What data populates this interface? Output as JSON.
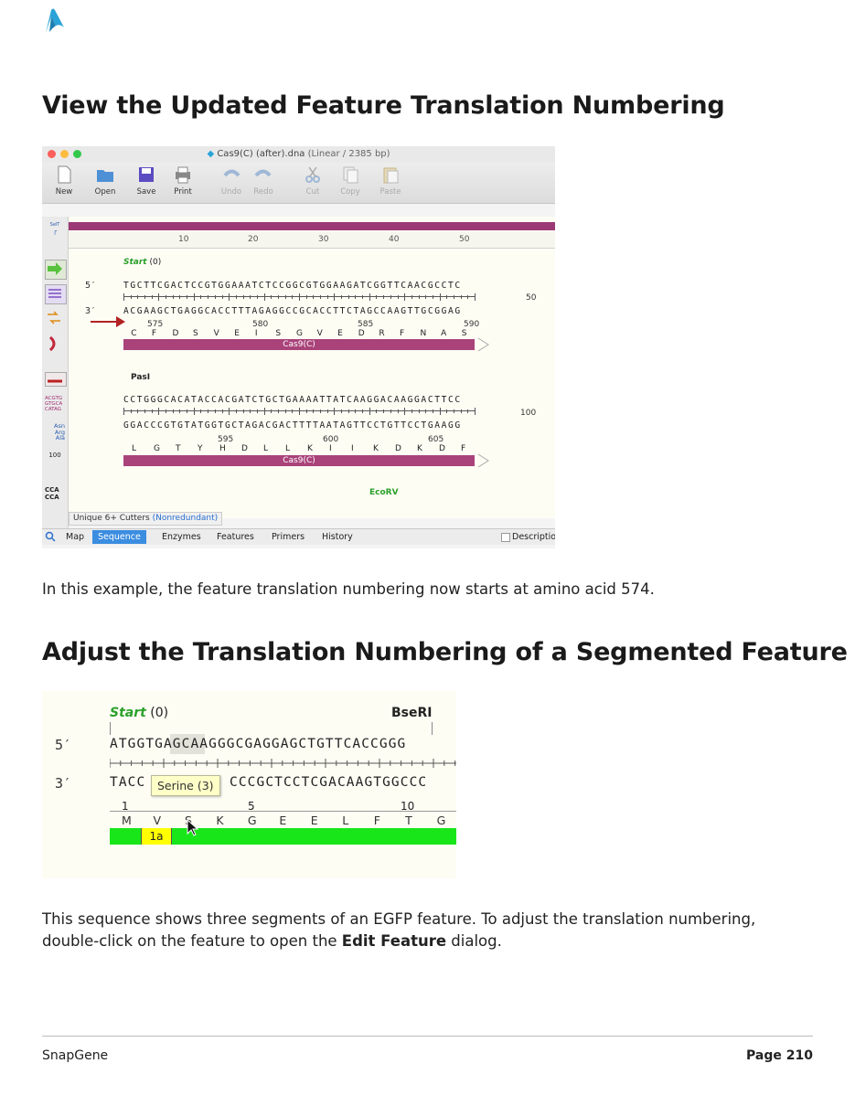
{
  "page": {
    "heading1": "View the Updated Feature Translation Numbering",
    "paragraph1": "In this example, the feature translation numbering now starts at amino acid 574.",
    "heading2": "Adjust the Translation Numbering of a Segmented Feature",
    "paragraph2_pre": "This sequence shows three segments of an EGFP feature. To adjust the translation numbering,",
    "paragraph2_line2_pre": "double-click on the feature to open the ",
    "paragraph2_bold": "Edit Feature",
    "paragraph2_post": " dialog."
  },
  "footer": {
    "left": "SnapGene",
    "right": "Page 210"
  },
  "screenshot1": {
    "window_title": "Cas9(C) (after).dna",
    "window_subtitle": "(Linear / 2385 bp)",
    "toolbar": [
      {
        "label": "New",
        "icon": "new-document-icon",
        "enabled": true
      },
      {
        "label": "Open",
        "icon": "open-folder-icon",
        "enabled": true
      },
      {
        "label": "Save",
        "icon": "save-disk-icon",
        "enabled": true
      },
      {
        "label": "Print",
        "icon": "printer-icon",
        "enabled": true
      },
      {
        "label": "Undo",
        "icon": "undo-icon",
        "enabled": false
      },
      {
        "label": "Redo",
        "icon": "redo-icon",
        "enabled": false
      },
      {
        "label": "Cut",
        "icon": "scissors-icon",
        "enabled": false
      },
      {
        "label": "Copy",
        "icon": "copy-icon",
        "enabled": false
      },
      {
        "label": "Paste",
        "icon": "paste-icon",
        "enabled": false
      }
    ],
    "ruler": [
      "10",
      "20",
      "30",
      "40",
      "50"
    ],
    "block1": {
      "feature_start": "Start",
      "feature_start_count": "(0)",
      "strand_top": "5′",
      "strand_bottom": "3′",
      "top_seq": "TGCTTCGACTCCGTGGAAATCTCCGGCGTGGAAGATCGGTTCAACGCCTC",
      "bottom_seq": "ACGAAGCTGAGGCACCTTTAGAGGCCGCACCTTCTAGCCAAGTTGCGGAG",
      "right_num": "50",
      "aa_numbers": [
        "575",
        "580",
        "585",
        "590"
      ],
      "aa_seq": [
        "C",
        "F",
        "D",
        "S",
        "V",
        "E",
        "I",
        "S",
        "G",
        "V",
        "E",
        "D",
        "R",
        "F",
        "N",
        "A",
        "S"
      ],
      "feature_name": "Cas9(C)"
    },
    "block2": {
      "enzyme": "PasI",
      "top_seq": "CCTGGGCACATACCACGATCTGCTGAAAATTATCAAGGACAAGGACTTCC",
      "bottom_seq": "GGACCCGTGTATGGTGCTAGACGACTTTTAATAGTTCCTGTTCCTGAAGG",
      "right_num": "100",
      "aa_numbers": [
        "595",
        "600",
        "605"
      ],
      "aa_seq": [
        "L",
        "G",
        "T",
        "Y",
        "H",
        "D",
        "L",
        "L",
        "K",
        "I",
        "I",
        "K",
        "D",
        "K",
        "D",
        "F"
      ],
      "feature_name": "Cas9(C)"
    },
    "block3": {
      "enzyme": "EcoRV"
    },
    "enzyme_filter": "Unique 6+ Cutters",
    "enzyme_filter_mode": "(Nonredundant)",
    "tabs": [
      "Map",
      "Sequence",
      "Enzymes",
      "Features",
      "Primers",
      "History"
    ],
    "active_tab": "Sequence",
    "description_checkbox": "Descriptio",
    "left_tools": [
      "select-tool-icon",
      "green-arrow-icon",
      "lines-icon",
      "swap-icon",
      "bracket-icon",
      "dna-strand-icon",
      "sequence-case-icon",
      "amino-acid-icon",
      "ruler-icon",
      "restriction-icon"
    ],
    "left_tool_text": {
      "seq": "ACGTG\nGTGCA\nCATAG",
      "aa": "Asn\nArg\nAla",
      "ruler": "100",
      "cca": "CCA\nCCA",
      "selector_tag": "SelT"
    }
  },
  "screenshot2": {
    "feature_start": "Start",
    "feature_start_count": "(0)",
    "enzyme": "BseRI",
    "strand_top": "5′",
    "strand_bottom": "3′",
    "top_seq": "ATGGTGAGCAAGGGCGAGGAGCTGTTCACCGGG",
    "highlight": "AGC",
    "bottom_seq_left": "TACC",
    "bottom_seq_right": "CCCGCTCCTCGACAAGTGGCCC",
    "tooltip": "Serine (3)",
    "aa_numbers": [
      "1",
      "5",
      "10"
    ],
    "aa_seq": [
      "M",
      "V",
      "S",
      "K",
      "G",
      "E",
      "E",
      "L",
      "F",
      "T",
      "G"
    ],
    "segment_label": "1a",
    "colors": {
      "segment_green": "#19e619",
      "segment_yellow": "#ffff00"
    }
  },
  "colors": {
    "feature_bar": "#a9437a",
    "enzyme_green": "#2ba02b",
    "arrow_red": "#b22222",
    "active_tab": "#3b8de0"
  }
}
